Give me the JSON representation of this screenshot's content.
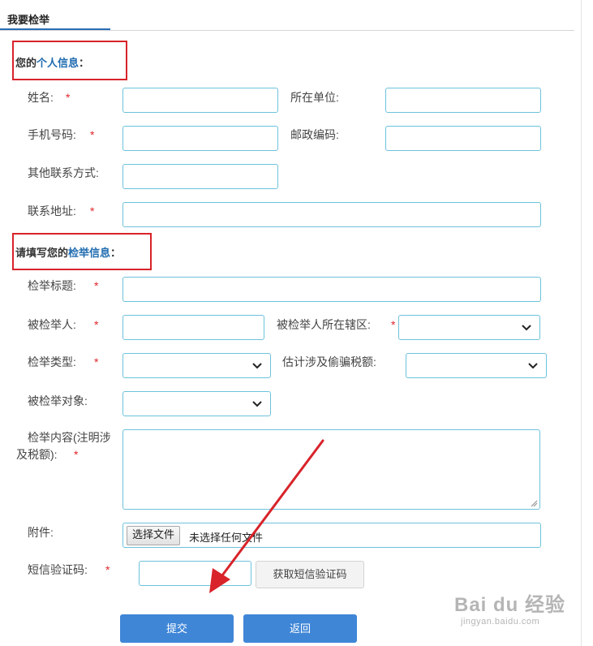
{
  "tab": {
    "label": "我要检举"
  },
  "personal_section": {
    "title_prefix": "您的",
    "title_highlight": "个人信息",
    "title_suffix": "："
  },
  "personal_fields": {
    "name_label": "姓名:",
    "employer_label": "所在单位:",
    "phone_label": "手机号码:",
    "postcode_label": "邮政编码:",
    "other_contact_label": "其他联系方式:",
    "address_label": "联系地址:"
  },
  "report_section": {
    "title_prefix": "请填写您的",
    "title_highlight": "检举信息",
    "title_suffix": "："
  },
  "report_fields": {
    "title_label": "检举标题:",
    "accused_label": "被检举人:",
    "district_label": "被检举人所在辖区:",
    "type_label": "检举类型:",
    "evasion_amount_label": "估计涉及偷骗税额:",
    "target_label": "被检举对象:",
    "content_label_line1": "检举内容(注明涉",
    "content_label_line2": "及税额):",
    "attachment_label": "附件:",
    "sms_code_label": "短信验证码:"
  },
  "required_mark": "*",
  "file_input": {
    "button_label": "选择文件",
    "status": "未选择任何文件"
  },
  "sms_button": {
    "label": "获取短信验证码"
  },
  "actions": {
    "submit_label": "提交",
    "back_label": "返回"
  },
  "watermark": {
    "main": "Bai du 经验",
    "sub": "jingyan.baidu.com"
  },
  "colors": {
    "accent": "#1f6bb0",
    "button": "#3f86d7",
    "highlight_box": "#d8232a",
    "input_border": "#6ec2dc",
    "required": "#e0262c",
    "annotation_arrow": "#d8232a"
  }
}
